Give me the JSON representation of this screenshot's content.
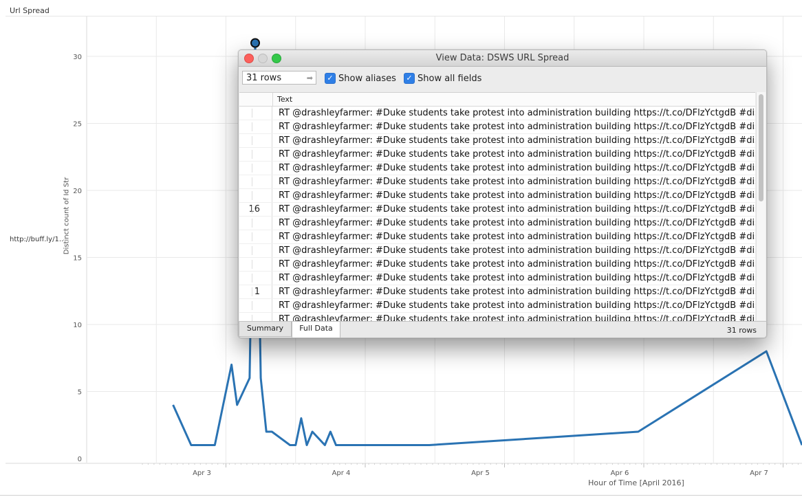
{
  "sheet": {
    "title": "Url Spread",
    "row_label": "http://buff.ly/1..",
    "colors": {
      "line": "#2a73b3",
      "grid": "#e9e9e9"
    }
  },
  "chart_data": {
    "type": "line",
    "title": "",
    "xlabel": "Hour of Time [April 2016]",
    "ylabel": "Distinct count of Id Str",
    "ylim": [
      0,
      31
    ],
    "yticks": [
      0,
      5,
      10,
      15,
      20,
      25,
      30
    ],
    "xticks": [
      {
        "label": "Apr 3",
        "day": 3
      },
      {
        "label": "Apr 4",
        "day": 4
      },
      {
        "label": "Apr 5",
        "day": 5
      },
      {
        "label": "Apr 6",
        "day": 6
      },
      {
        "label": "Apr 7",
        "day": 7
      }
    ],
    "xlim": [
      2.4,
      7.3
    ],
    "series": [
      {
        "points": [
          {
            "x": 2.62,
            "y": 4
          },
          {
            "x": 2.75,
            "y": 1
          },
          {
            "x": 2.92,
            "y": 1
          },
          {
            "x": 3.04,
            "y": 7
          },
          {
            "x": 3.08,
            "y": 4
          },
          {
            "x": 3.17,
            "y": 6
          },
          {
            "x": 3.21,
            "y": 31
          },
          {
            "x": 3.25,
            "y": 6
          },
          {
            "x": 3.29,
            "y": 2
          },
          {
            "x": 3.33,
            "y": 2
          },
          {
            "x": 3.46,
            "y": 1
          },
          {
            "x": 3.5,
            "y": 1
          },
          {
            "x": 3.54,
            "y": 3
          },
          {
            "x": 3.58,
            "y": 1
          },
          {
            "x": 3.62,
            "y": 2
          },
          {
            "x": 3.71,
            "y": 1
          },
          {
            "x": 3.75,
            "y": 2
          },
          {
            "x": 3.79,
            "y": 1
          },
          {
            "x": 4.46,
            "y": 1
          },
          {
            "x": 5.96,
            "y": 2
          },
          {
            "x": 6.88,
            "y": 8
          },
          {
            "x": 7.17,
            "y": 1
          },
          {
            "x": 7.29,
            "y": 1
          }
        ],
        "highlight_index": 6
      }
    ],
    "grid": true
  },
  "dialog": {
    "title": "View Data:  DSWS URL Spread",
    "rows_value": "31 rows",
    "show_aliases_label": "Show aliases",
    "show_all_fields_label": "Show all fields",
    "column_header": "Text",
    "rows": [
      {
        "num": "",
        "text": "RT @drashleyfarmer: #Duke students take protest into administration building https://t.co/DFlzYctgdB #dism"
      },
      {
        "num": "",
        "text": "RT @drashleyfarmer: #Duke students take protest into administration building https://t.co/DFlzYctgdB #dism"
      },
      {
        "num": "",
        "text": "RT @drashleyfarmer: #Duke students take protest into administration building https://t.co/DFlzYctgdB #dism"
      },
      {
        "num": "",
        "text": "RT @drashleyfarmer: #Duke students take protest into administration building https://t.co/DFlzYctgdB #dism"
      },
      {
        "num": "",
        "text": "RT @drashleyfarmer: #Duke students take protest into administration building https://t.co/DFlzYctgdB #dism"
      },
      {
        "num": "",
        "text": "RT @drashleyfarmer: #Duke students take protest into administration building https://t.co/DFlzYctgdB #dism"
      },
      {
        "num": "",
        "text": "RT @drashleyfarmer: #Duke students take protest into administration building https://t.co/DFlzYctgdB #dism"
      },
      {
        "num": "16",
        "text": "RT @drashleyfarmer: #Duke students take protest into administration building https://t.co/DFlzYctgdB #dism"
      },
      {
        "num": "",
        "text": "RT @drashleyfarmer: #Duke students take protest into administration building https://t.co/DFlzYctgdB #dism"
      },
      {
        "num": "",
        "text": "RT @drashleyfarmer: #Duke students take protest into administration building https://t.co/DFlzYctgdB #dism"
      },
      {
        "num": "",
        "text": "RT @drashleyfarmer: #Duke students take protest into administration building https://t.co/DFlzYctgdB #dism"
      },
      {
        "num": "",
        "text": "RT @drashleyfarmer: #Duke students take protest into administration building https://t.co/DFlzYctgdB #dism"
      },
      {
        "num": "",
        "text": "RT @drashleyfarmer: #Duke students take protest into administration building https://t.co/DFlzYctgdB #dism"
      },
      {
        "num": "1",
        "text": "RT @drashleyfarmer: #Duke students take protest into administration building https://t.co/DFlzYctgdB #dism"
      },
      {
        "num": "",
        "text": "RT @drashleyfarmer: #Duke students take protest into administration building https://t.co/DFlzYctgdB #dism"
      },
      {
        "num": "",
        "text": "RT @drashleyfarmer: #Duke students take protest into administration building https://t.co/DFlzYctgdB #dism"
      }
    ],
    "tabs": [
      "Summary",
      "Full Data"
    ],
    "active_tab": "Full Data",
    "row_count": "31 rows"
  }
}
